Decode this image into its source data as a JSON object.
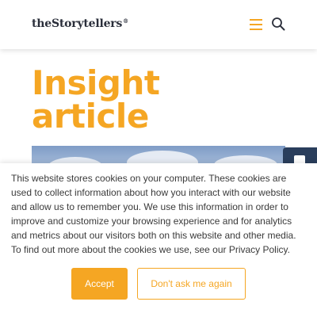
{
  "header": {
    "logo_text": "theStorytellers",
    "logo_mark": "®",
    "menu_icon": "hamburger-icon",
    "search_icon": "search-icon"
  },
  "hero": {
    "title_line1": "Insight",
    "title_line2": "article"
  },
  "cookie_banner": {
    "text": "This website stores cookies on your computer. These cookies are used to collect information about how you interact with our website and allow us to remember you. We use this information in order to improve and customize your browsing experience and for analytics and metrics about our visitors both on this website and other media. To find out more about the cookies we use, see our Privacy Policy.",
    "accept_label": "Accept",
    "deny_label": "Don't ask me again"
  },
  "colors": {
    "accent": "#f5a623",
    "text": "#3a3a3a",
    "side_tab": "#2a3e5c"
  }
}
